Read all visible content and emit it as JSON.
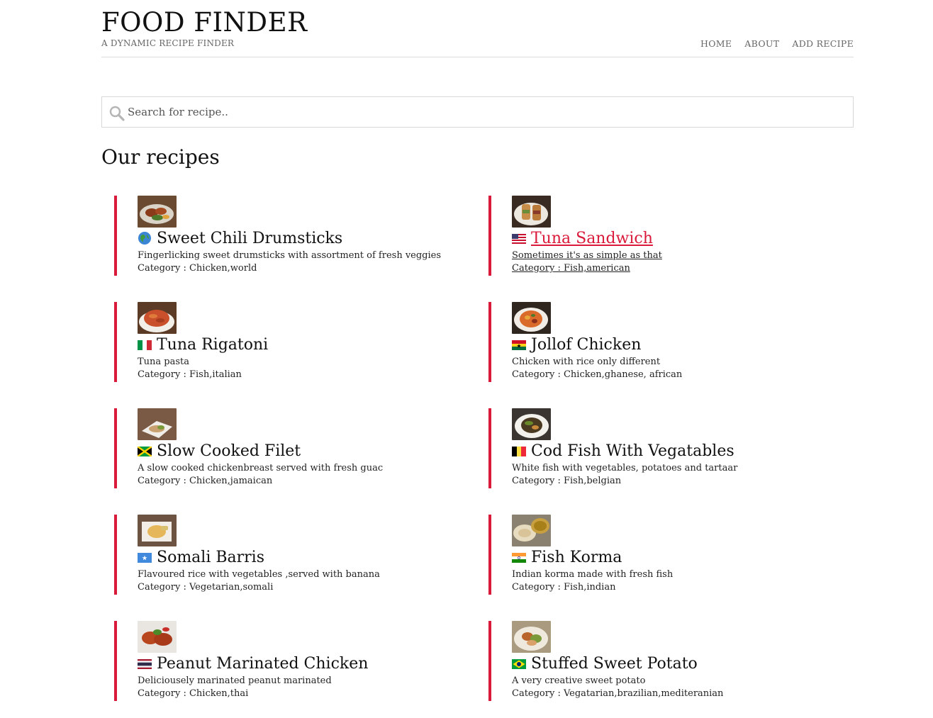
{
  "site": {
    "title": "FOOD FINDER",
    "subtitle": "A DYNAMIC RECIPE FINDER"
  },
  "nav": [
    {
      "label": "HOME"
    },
    {
      "label": "ABOUT"
    },
    {
      "label": "ADD RECIPE"
    }
  ],
  "search": {
    "placeholder": "Search for recipe..",
    "value": ""
  },
  "section_title": "Our recipes",
  "category_prefix": "Category : ",
  "colors": {
    "accent": "#d91a3a",
    "border": "#d8d8d8"
  },
  "recipes": [
    {
      "name": "Sweet Chili Drumsticks",
      "desc": "Fingerlicking sweet drumsticks with assortment of fresh veggies",
      "category": "Chicken,world",
      "flag": "globe-icon",
      "active": false
    },
    {
      "name": "Tuna Sandwich",
      "desc": "Sometimes it's as simple as that",
      "category": "Fish,american",
      "flag": "flag-us-icon",
      "active": true
    },
    {
      "name": "Tuna Rigatoni",
      "desc": "Tuna pasta",
      "category": "Fish,italian",
      "flag": "flag-it-icon",
      "active": false
    },
    {
      "name": "Jollof Chicken",
      "desc": "Chicken with rice only different",
      "category": "Chicken,ghanese, african",
      "flag": "flag-gh-icon",
      "active": false
    },
    {
      "name": "Slow Cooked Filet",
      "desc": "A slow cooked chickenbreast served with fresh guac",
      "category": "Chicken,jamaican",
      "flag": "flag-jm-icon",
      "active": false
    },
    {
      "name": "Cod Fish With Vegatables",
      "desc": "White fish with vegetables, potatoes and tartaar",
      "category": "Fish,belgian",
      "flag": "flag-be-icon",
      "active": false
    },
    {
      "name": "Somali Barris",
      "desc": "Flavoured rice with vegetables ,served with banana",
      "category": "Vegetarian,somali",
      "flag": "flag-so-icon",
      "active": false
    },
    {
      "name": "Fish Korma",
      "desc": "Indian korma made with fresh fish",
      "category": "Fish,indian",
      "flag": "flag-in-icon",
      "active": false
    },
    {
      "name": "Peanut Marinated Chicken",
      "desc": "Deliciousely marinated peanut marinated",
      "category": "Chicken,thai",
      "flag": "flag-th-icon",
      "active": false
    },
    {
      "name": "Stuffed Sweet Potato",
      "desc": "A very creative sweet potato",
      "category": "Vegatarian,brazilian,mediteranian",
      "flag": "flag-br-icon",
      "active": false
    }
  ]
}
